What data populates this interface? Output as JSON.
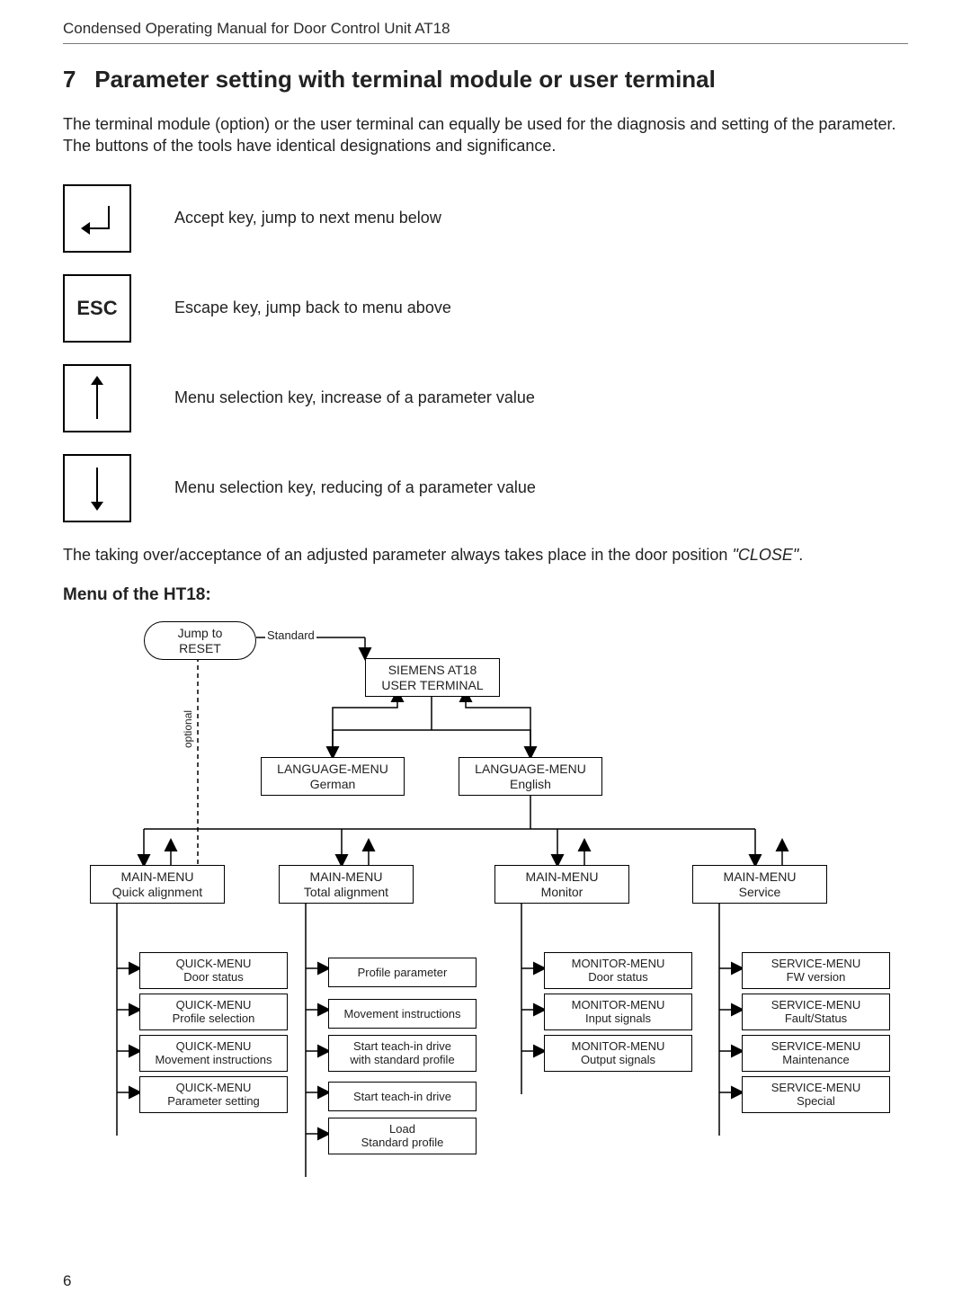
{
  "running_head": "Condensed Operating Manual for Door Control Unit AT18",
  "section": {
    "number": "7",
    "title": "Parameter setting with terminal module or user terminal"
  },
  "intro": "The terminal module (option) or the user terminal can equally be used for the diagnosis and setting of the parameter. The buttons of the tools have identical designations and significance.",
  "keys": {
    "enter": {
      "label": "",
      "desc": "Accept key, jump to next menu below"
    },
    "esc": {
      "label": "ESC",
      "desc": "Escape key, jump back to menu above"
    },
    "up": {
      "label": "",
      "desc": "Menu selection key, increase of a parameter value"
    },
    "down": {
      "label": "",
      "desc": "Menu selection key, reducing of a parameter value"
    }
  },
  "note_prefix": "The taking over/acceptance of an adjusted parameter always takes place in the door position ",
  "note_emph": "\"CLOSE\"",
  "note_suffix": ".",
  "menu_head": "Menu of the HT18:",
  "diagram": {
    "reset": {
      "l1": "Jump to",
      "l2": "RESET"
    },
    "standard": "Standard",
    "optional": "optional",
    "root": {
      "l1": "SIEMENS AT18",
      "l2": "USER TERMINAL"
    },
    "lang_de": {
      "l1": "LANGUAGE-MENU",
      "l2": "German"
    },
    "lang_en": {
      "l1": "LANGUAGE-MENU",
      "l2": "English"
    },
    "main_quick": {
      "l1": "MAIN-MENU",
      "l2": "Quick alignment"
    },
    "main_total": {
      "l1": "MAIN-MENU",
      "l2": "Total alignment"
    },
    "main_mon": {
      "l1": "MAIN-MENU",
      "l2": "Monitor"
    },
    "main_svc": {
      "l1": "MAIN-MENU",
      "l2": "Service"
    },
    "q1": {
      "l1": "QUICK-MENU",
      "l2": "Door status"
    },
    "q2": {
      "l1": "QUICK-MENU",
      "l2": "Profile selection"
    },
    "q3": {
      "l1": "QUICK-MENU",
      "l2": "Movement instructions"
    },
    "q4": {
      "l1": "QUICK-MENU",
      "l2": "Parameter setting"
    },
    "t1": "Profile parameter",
    "t2": "Movement instructions",
    "t3": {
      "l1": "Start teach-in drive",
      "l2": "with standard profile"
    },
    "t4": "Start teach-in drive",
    "t5": {
      "l1": "Load",
      "l2": "Standard profile"
    },
    "m1": {
      "l1": "MONITOR-MENU",
      "l2": "Door status"
    },
    "m2": {
      "l1": "MONITOR-MENU",
      "l2": "Input signals"
    },
    "m3": {
      "l1": "MONITOR-MENU",
      "l2": "Output signals"
    },
    "s1": {
      "l1": "SERVICE-MENU",
      "l2": "FW version"
    },
    "s2": {
      "l1": "SERVICE-MENU",
      "l2": "Fault/Status"
    },
    "s3": {
      "l1": "SERVICE-MENU",
      "l2": "Maintenance"
    },
    "s4": {
      "l1": "SERVICE-MENU",
      "l2": "Special"
    }
  },
  "page_number": "6"
}
